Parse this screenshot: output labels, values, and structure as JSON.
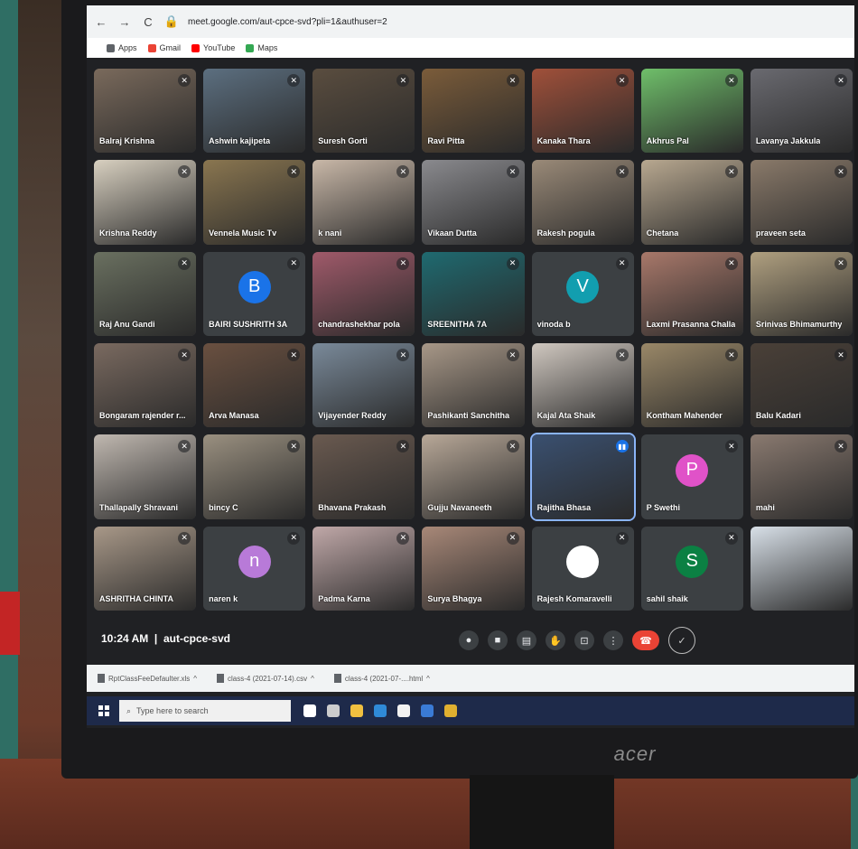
{
  "browser": {
    "url": "meet.google.com/aut-cpce-svd?pli=1&authuser=2",
    "bookmarks": [
      {
        "label": "Apps",
        "icon": "apps-icon",
        "color": "#5f6368"
      },
      {
        "label": "Gmail",
        "icon": "gmail-icon",
        "color": "#ea4335"
      },
      {
        "label": "YouTube",
        "icon": "youtube-icon",
        "color": "#ff0000"
      },
      {
        "label": "Maps",
        "icon": "maps-icon",
        "color": "#34a853"
      }
    ]
  },
  "participants": [
    {
      "name": "Balraj Krishna",
      "bg": "#7a6a5c"
    },
    {
      "name": "Ashwin kajipeta",
      "bg": "#5c6f80"
    },
    {
      "name": "Suresh Gorti",
      "bg": "#5a4d3f"
    },
    {
      "name": "Ravi Pitta",
      "bg": "#7b5c3a"
    },
    {
      "name": "Kanaka Thara",
      "bg": "#a0503a"
    },
    {
      "name": "Akhrus Pal",
      "bg": "#6fbf6a"
    },
    {
      "name": "Lavanya Jakkula",
      "bg": "#6a6a70"
    },
    {
      "name": "Krishna Reddy",
      "bg": "#d8d0c0"
    },
    {
      "name": "Vennela Music Tv",
      "bg": "#8a7650"
    },
    {
      "name": "k nani",
      "bg": "#c9b8a8"
    },
    {
      "name": "Vikaan Dutta",
      "bg": "#8a8a8e"
    },
    {
      "name": "Rakesh pogula",
      "bg": "#9a8a78"
    },
    {
      "name": "Chetana",
      "bg": "#b8a890"
    },
    {
      "name": "praveen seta",
      "bg": "#8a7a6a"
    },
    {
      "name": "Raj Anu Gandi",
      "bg": "#6a7060"
    },
    {
      "name": "BAIRI SUSHRITH 3A",
      "avatar": "B",
      "avatar_color": "#1a73e8"
    },
    {
      "name": "chandrashekhar pola",
      "bg": "#a05a6a"
    },
    {
      "name": "SREENITHA 7A",
      "bg": "#1f6a70"
    },
    {
      "name": "vinoda b",
      "avatar": "V",
      "avatar_color": "#129eaf"
    },
    {
      "name": "Laxmi Prasanna Challa",
      "bg": "#a8786a"
    },
    {
      "name": "Srinivas Bhimamurthy",
      "bg": "#b0a080"
    },
    {
      "name": "Bongaram rajender r...",
      "bg": "#7a6a60"
    },
    {
      "name": "Arva Manasa",
      "bg": "#6a5040"
    },
    {
      "name": "Vijayender Reddy",
      "bg": "#7a8a9a"
    },
    {
      "name": "Pashikanti Sanchitha",
      "bg": "#a89888"
    },
    {
      "name": "Kajal Ata Shaik",
      "bg": "#d0c8c0"
    },
    {
      "name": "Kontham Mahender",
      "bg": "#9a8868"
    },
    {
      "name": "Balu Kadari",
      "bg": "#4a4038"
    },
    {
      "name": "Thallapally Shravani",
      "bg": "#c0b8b0"
    },
    {
      "name": "bincy C",
      "bg": "#9a9080"
    },
    {
      "name": "Bhavana Prakash",
      "bg": "#6a5a50"
    },
    {
      "name": "Gujju Navaneeth",
      "bg": "#b8a898"
    },
    {
      "name": "Rajitha Bhasa",
      "bg": "#3a5070",
      "active": true
    },
    {
      "name": "P Swethi",
      "avatar": "P",
      "avatar_color": "#e052c8"
    },
    {
      "name": "mahi",
      "bg": "#8a7a70"
    },
    {
      "name": "ASHRITHA CHINTA",
      "bg": "#a89888"
    },
    {
      "name": "naren k",
      "avatar": "n",
      "avatar_color": "#b87ad8"
    },
    {
      "name": "Padma Karna",
      "bg": "#c0a8a8"
    },
    {
      "name": "Surya Bhagya",
      "bg": "#a88878"
    },
    {
      "name": "Rajesh Komaravelli",
      "avatar_photo": true,
      "avatar_color": "#ffffff"
    },
    {
      "name": "sahil shaik",
      "avatar": "S",
      "avatar_color": "#0b8043"
    },
    {
      "name": "",
      "bg": "#d8e0e8"
    }
  ],
  "meeting": {
    "time": "10:24 AM",
    "code": "aut-cpce-svd",
    "controls": [
      {
        "id": "mic",
        "icon": "microphone-icon",
        "glyph": "●"
      },
      {
        "id": "camera",
        "icon": "camera-icon",
        "glyph": "■"
      },
      {
        "id": "captions",
        "icon": "captions-icon",
        "glyph": "▤"
      },
      {
        "id": "raise-hand",
        "icon": "hand-icon",
        "glyph": "✋"
      },
      {
        "id": "present",
        "icon": "present-icon",
        "glyph": "⊡"
      },
      {
        "id": "more",
        "icon": "more-options-icon",
        "glyph": "⋮"
      },
      {
        "id": "leave",
        "icon": "end-call-icon",
        "glyph": "☎"
      },
      {
        "id": "done",
        "icon": "check-icon",
        "glyph": "✓"
      }
    ]
  },
  "downloads": [
    {
      "label": "RptClassFeeDefaulter.xls"
    },
    {
      "label": "class-4 (2021-07-14).csv"
    },
    {
      "label": "class-4 (2021-07-....html"
    }
  ],
  "taskbar": {
    "search_placeholder": "Type here to search",
    "icons": [
      {
        "name": "cortana-icon",
        "color": "#ffffff"
      },
      {
        "name": "task-view-icon",
        "color": "#cccccc"
      },
      {
        "name": "file-explorer-icon",
        "color": "#f0c040"
      },
      {
        "name": "edge-icon",
        "color": "#2f8ad8"
      },
      {
        "name": "store-icon",
        "color": "#f2f2f2"
      },
      {
        "name": "mail-icon",
        "color": "#3a7bd5"
      },
      {
        "name": "chrome-icon",
        "color": "#e0b030"
      }
    ]
  },
  "monitor": {
    "brand": "acer"
  }
}
